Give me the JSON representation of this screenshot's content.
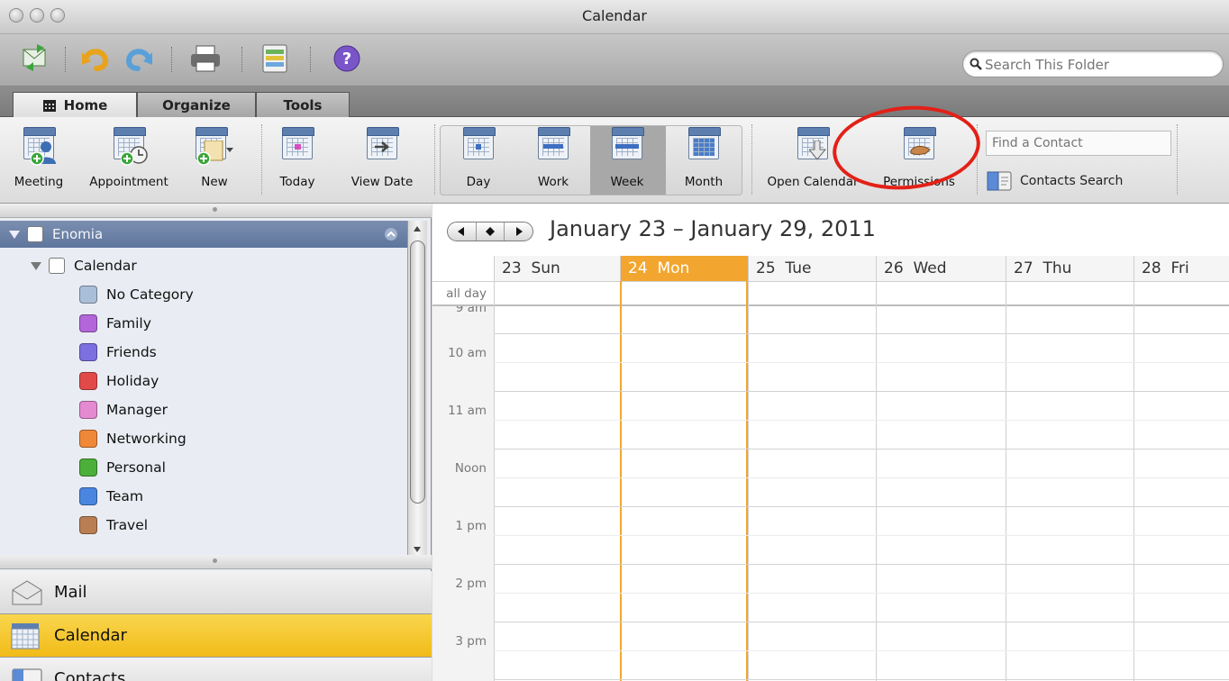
{
  "window": {
    "title": "Calendar"
  },
  "toolbar": {
    "icons": [
      "send-receive-icon",
      "undo-icon",
      "redo-icon",
      "print-icon",
      "reading-pane-icon",
      "help-icon"
    ],
    "search_placeholder": "Search This Folder"
  },
  "tabs": [
    {
      "label": "Home",
      "active": true
    },
    {
      "label": "Organize",
      "active": false
    },
    {
      "label": "Tools",
      "active": false
    }
  ],
  "ribbon": {
    "new_group": [
      "Meeting",
      "Appointment",
      "New"
    ],
    "goto_group": [
      "Today",
      "View Date"
    ],
    "views": [
      {
        "label": "Day",
        "selected": false
      },
      {
        "label": "Work",
        "selected": false
      },
      {
        "label": "Week",
        "selected": true
      },
      {
        "label": "Month",
        "selected": false
      }
    ],
    "share_group": [
      "Open Calendar",
      "Permissions"
    ],
    "find_contact_placeholder": "Find a Contact",
    "contacts_search": "Contacts Search"
  },
  "sidebar": {
    "account": "Enomia",
    "calendar": "Calendar",
    "categories": [
      {
        "name": "No Category",
        "color": "#a9bfd9"
      },
      {
        "name": "Family",
        "color": "#b266d9"
      },
      {
        "name": "Friends",
        "color": "#7c6fe0"
      },
      {
        "name": "Holiday",
        "color": "#e24a4a"
      },
      {
        "name": "Manager",
        "color": "#e48ad1"
      },
      {
        "name": "Networking",
        "color": "#f0883a"
      },
      {
        "name": "Personal",
        "color": "#4caf3a"
      },
      {
        "name": "Team",
        "color": "#4a86e0"
      },
      {
        "name": "Travel",
        "color": "#b97e52"
      }
    ],
    "nav": [
      {
        "label": "Mail",
        "active": false
      },
      {
        "label": "Calendar",
        "active": true
      },
      {
        "label": "Contacts",
        "active": false
      }
    ]
  },
  "calendar": {
    "range": "January 23 – January 29, 2011",
    "days": [
      {
        "num": "23",
        "name": "Sun",
        "today": false
      },
      {
        "num": "24",
        "name": "Mon",
        "today": true
      },
      {
        "num": "25",
        "name": "Tue",
        "today": false
      },
      {
        "num": "26",
        "name": "Wed",
        "today": false
      },
      {
        "num": "27",
        "name": "Thu",
        "today": false
      },
      {
        "num": "28",
        "name": "Fri",
        "today": false
      }
    ],
    "allday_label": "all day",
    "hours": [
      "9 am",
      "10 am",
      "11 am",
      "Noon",
      "1 pm",
      "2 pm",
      "3 pm"
    ],
    "today_color": "#f2a62f"
  }
}
